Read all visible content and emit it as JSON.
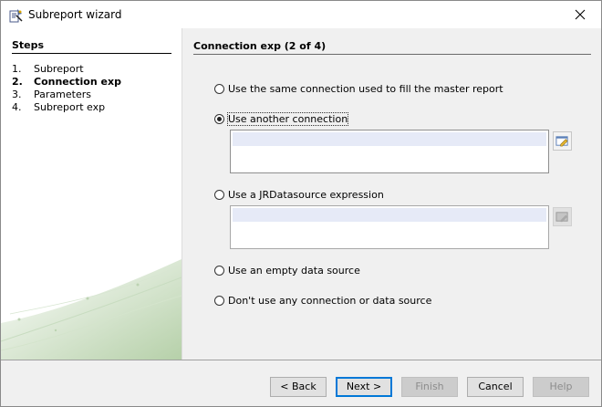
{
  "window": {
    "title": "Subreport wizard"
  },
  "steps": {
    "title": "Steps",
    "items": [
      {
        "num": "1.",
        "label": "Subreport"
      },
      {
        "num": "2.",
        "label": "Connection exp"
      },
      {
        "num": "3.",
        "label": "Parameters"
      },
      {
        "num": "4.",
        "label": "Subreport exp"
      }
    ]
  },
  "main": {
    "title": "Connection exp (2 of 4)",
    "options": {
      "same_connection": "Use the same connection used to fill the master report",
      "another_connection": "Use another connection",
      "jr_datasource": "Use a JRDatasource expression",
      "empty_datasource": "Use an empty data source",
      "no_connection": "Don't use any connection or data source"
    },
    "selected": "another_connection",
    "connection_expression": "",
    "datasource_expression": ""
  },
  "buttons": {
    "back": "< Back",
    "next": "Next >",
    "finish": "Finish",
    "cancel": "Cancel",
    "help": "Help"
  },
  "icons": {
    "app": "wizard-app-icon",
    "close": "close-icon",
    "edit_expression": "expression-editor-icon",
    "edit_expression_disabled": "expression-editor-disabled-icon"
  }
}
